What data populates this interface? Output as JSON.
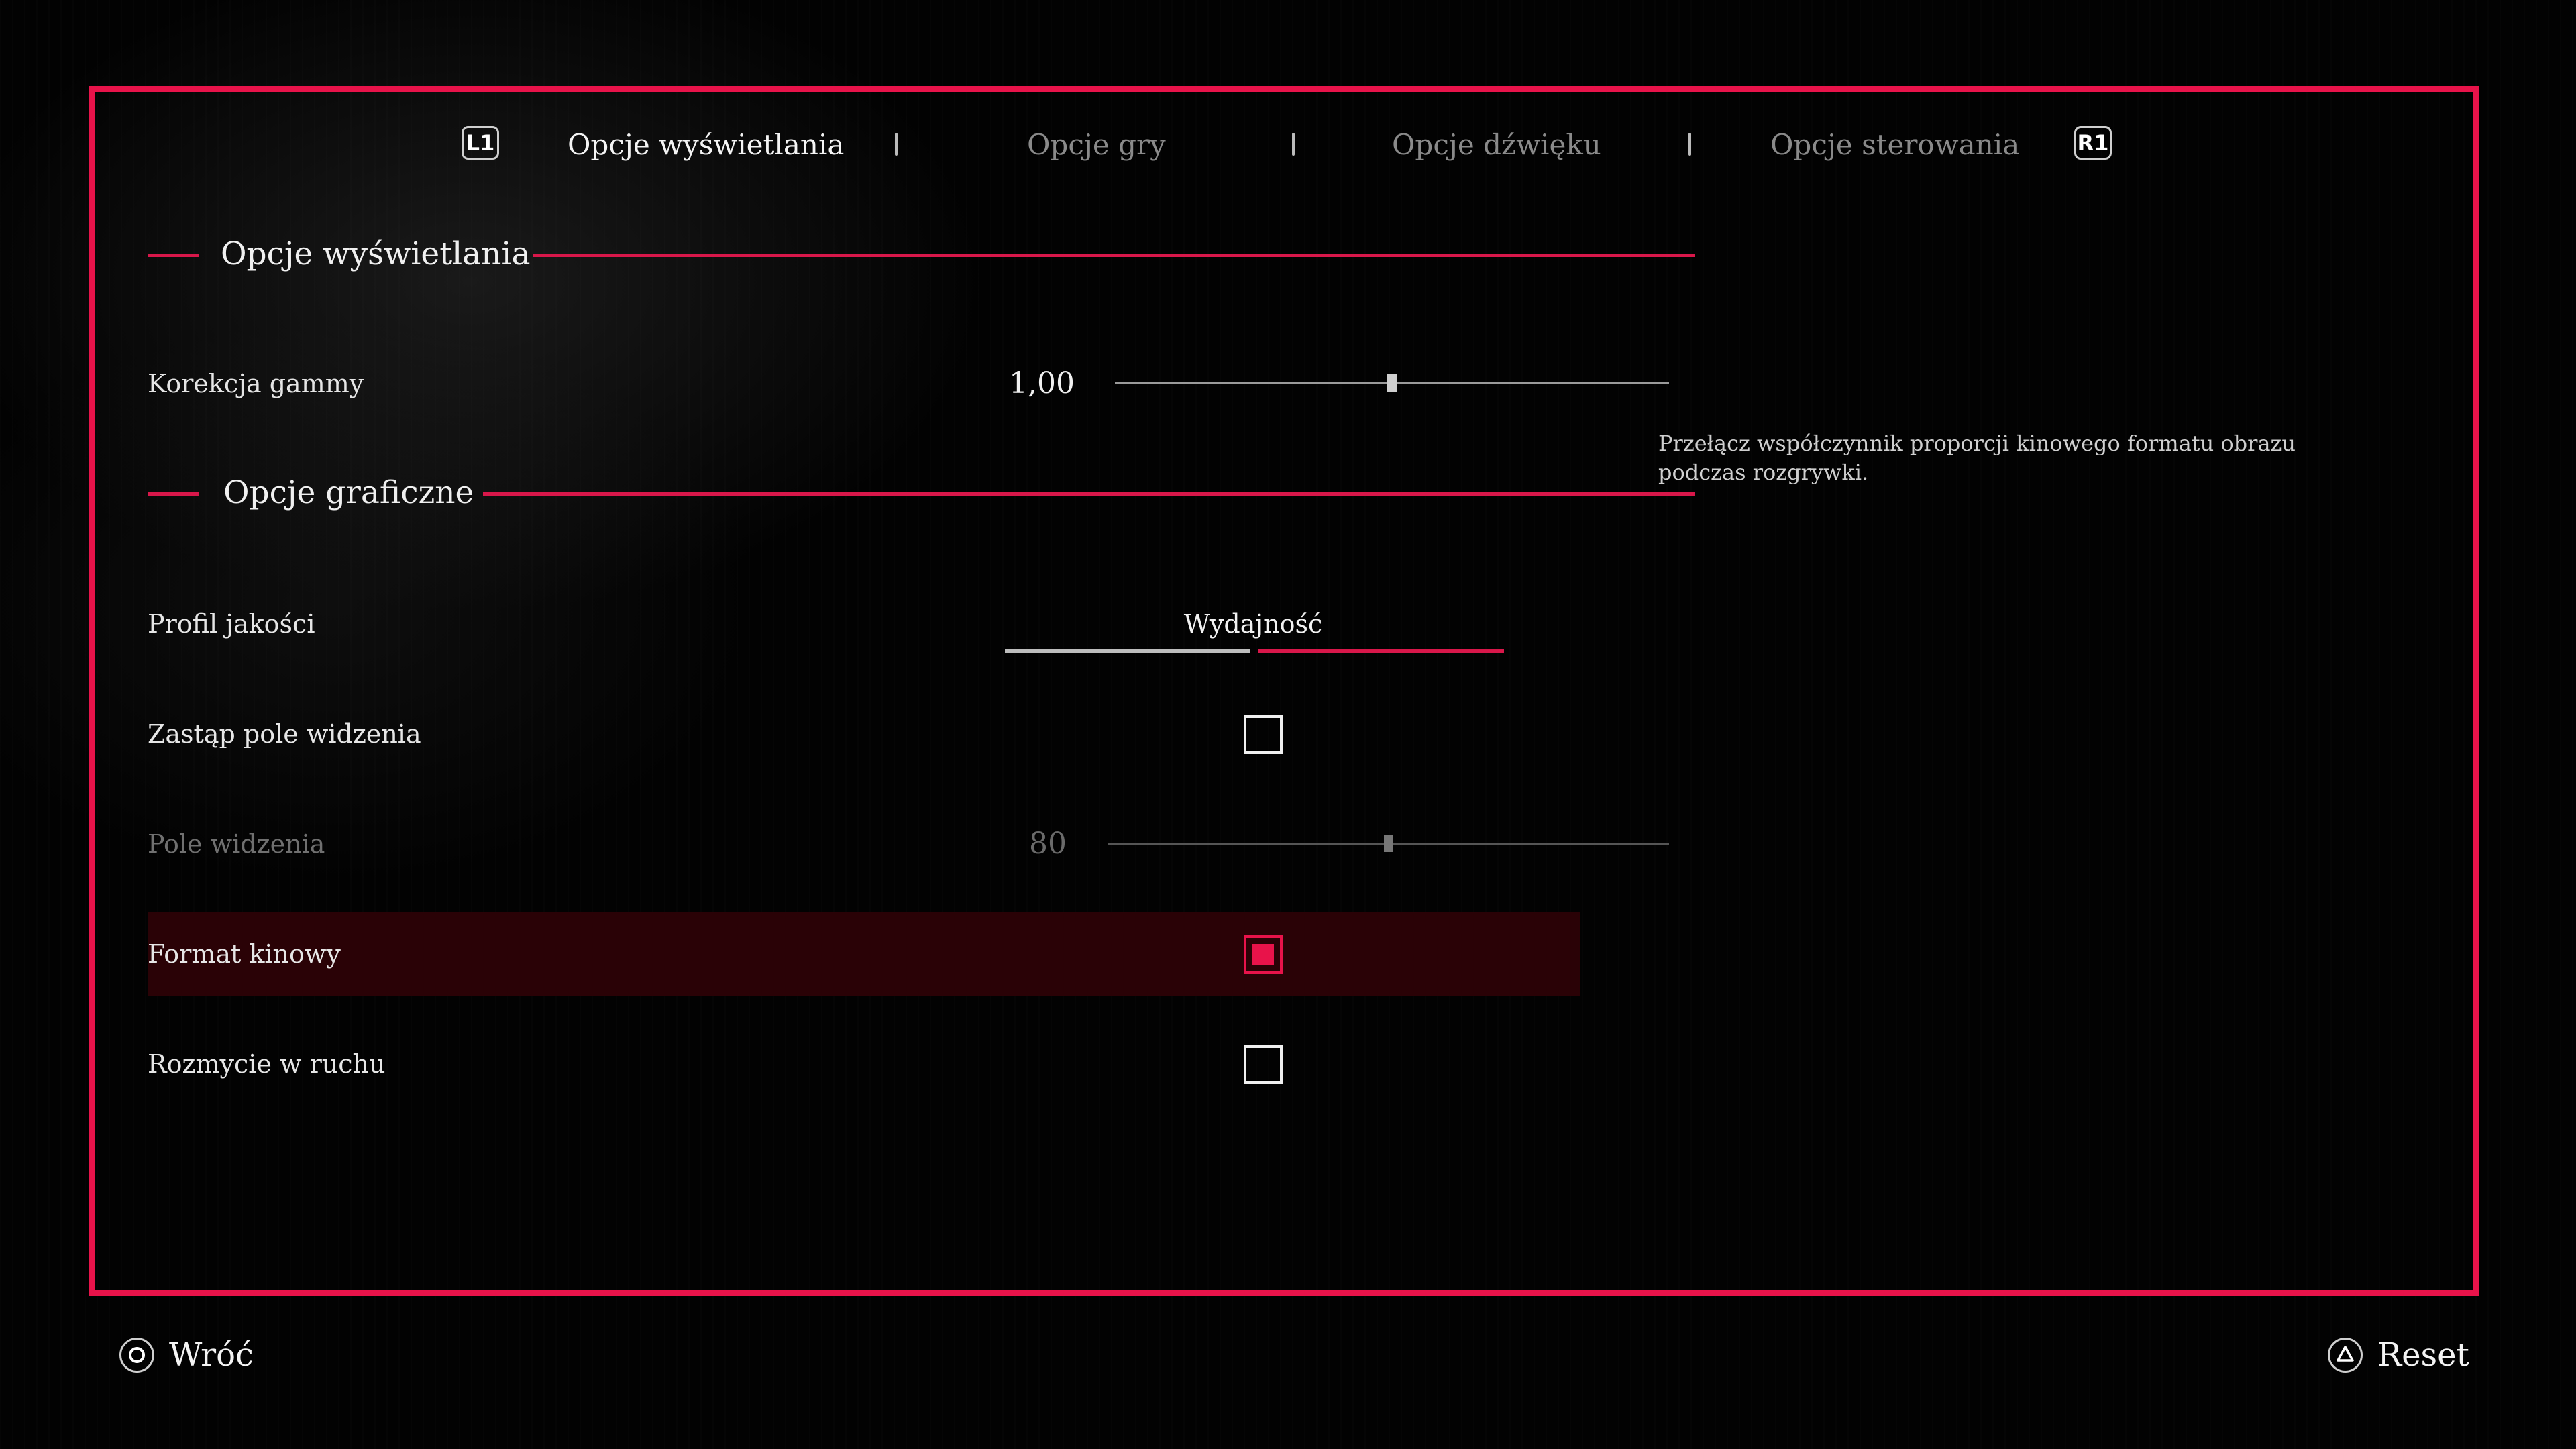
{
  "tabs": {
    "left_button": "L1",
    "right_button": "R1",
    "items": [
      {
        "label": "Opcje wyświetlania",
        "active": true
      },
      {
        "label": "Opcje gry",
        "active": false
      },
      {
        "label": "Opcje dźwięku",
        "active": false
      },
      {
        "label": "Opcje sterowania",
        "active": false
      }
    ]
  },
  "sections": {
    "display": {
      "title": "Opcje wyświetlania"
    },
    "graphics": {
      "title": "Opcje graficzne"
    }
  },
  "settings": {
    "gamma": {
      "label": "Korekcja gammy",
      "value": "1,00",
      "level": 0.5
    },
    "quality_profile": {
      "label": "Profil jakości",
      "value": "Wydajność"
    },
    "override_fov": {
      "label": "Zastąp pole widzenia",
      "checked": false
    },
    "fov": {
      "label": "Pole widzenia",
      "value": "80",
      "level": 0.5,
      "disabled": true
    },
    "cinematic": {
      "label": "Format kinowy",
      "checked": true,
      "selected": true
    },
    "motion_blur": {
      "label": "Rozmycie w ruchu",
      "checked": false
    }
  },
  "description": "Przełącz współczynnik proporcji kinowego formatu obrazu podczas rozgrywki.",
  "footer": {
    "back": {
      "label": "Wróć",
      "icon": "circle-button-icon"
    },
    "reset": {
      "label": "Reset",
      "icon": "triangle-button-icon"
    }
  },
  "colors": {
    "accent": "#e8134a",
    "selected_row": "#2a0206"
  }
}
